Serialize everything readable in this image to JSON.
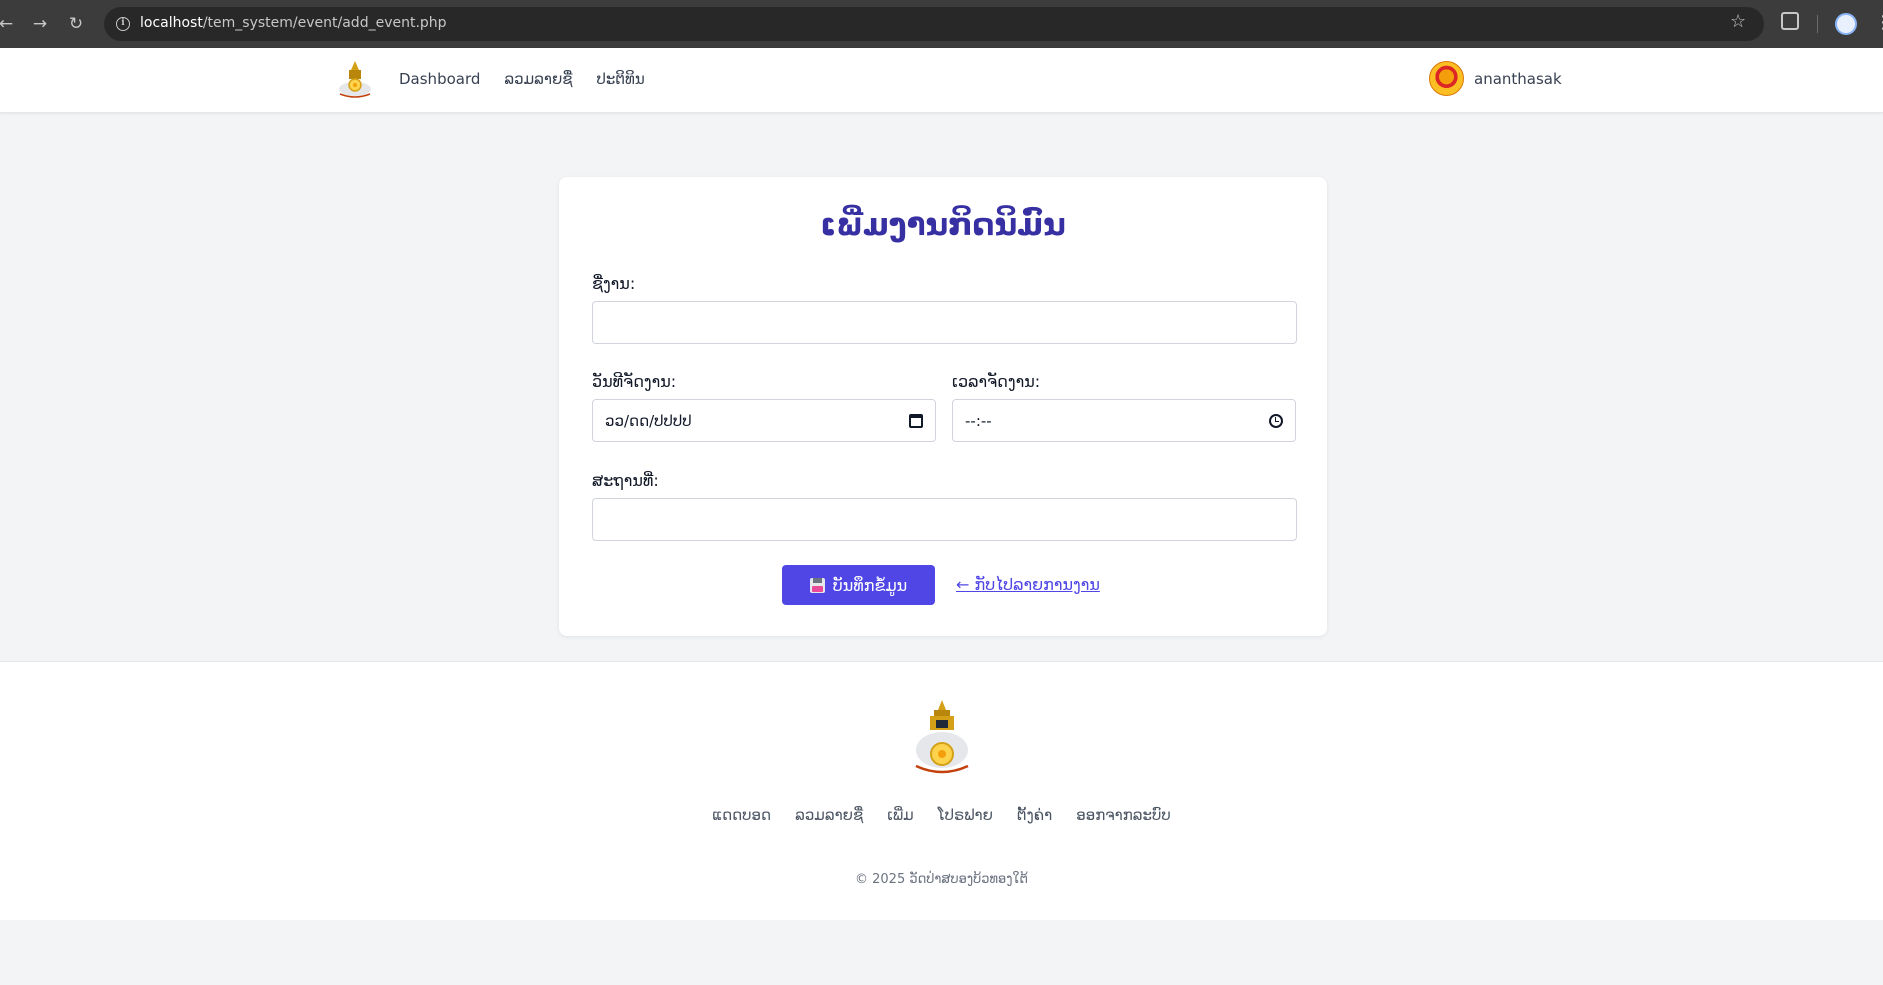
{
  "browser": {
    "url_host": "localhost",
    "url_path": "/tem_system/event/add_event.php"
  },
  "header": {
    "nav": [
      "Dashboard",
      "ລວມລາຍຊື່",
      "ປະຕິທິນ"
    ],
    "username": "ananthasak"
  },
  "form": {
    "title": "ເພີ່ມງານກິດນິມົນ",
    "name_label": "ຊື່ງານ:",
    "name_value": "",
    "date_label": "ວັນທີຈັດງານ:",
    "date_value": "ວວ/ດດ/ປປປປ",
    "time_label": "ເວລາຈັດງານ:",
    "time_value": "--:--",
    "place_label": "ສະຖານທີ່:",
    "place_value": "",
    "save_label": "ບັນທຶກຂໍ້ມູນ",
    "back_label": "← ກັບໄປລາຍການງານ"
  },
  "footer": {
    "links": [
      "ແດດບອດ",
      "ລວມລາຍຊື່",
      "ເພີ່ມ",
      "ໂປຣຟາຍ",
      "ຕັ້ງຄ່າ",
      "ອອກຈາກລະບົບ"
    ],
    "copyright": "© 2025 ວັດປ່າສບອງບ້ວທອງໃຕ້"
  },
  "colors": {
    "accent": "#4f46e5",
    "title": "#3730a3",
    "page_bg": "#f3f4f6"
  }
}
